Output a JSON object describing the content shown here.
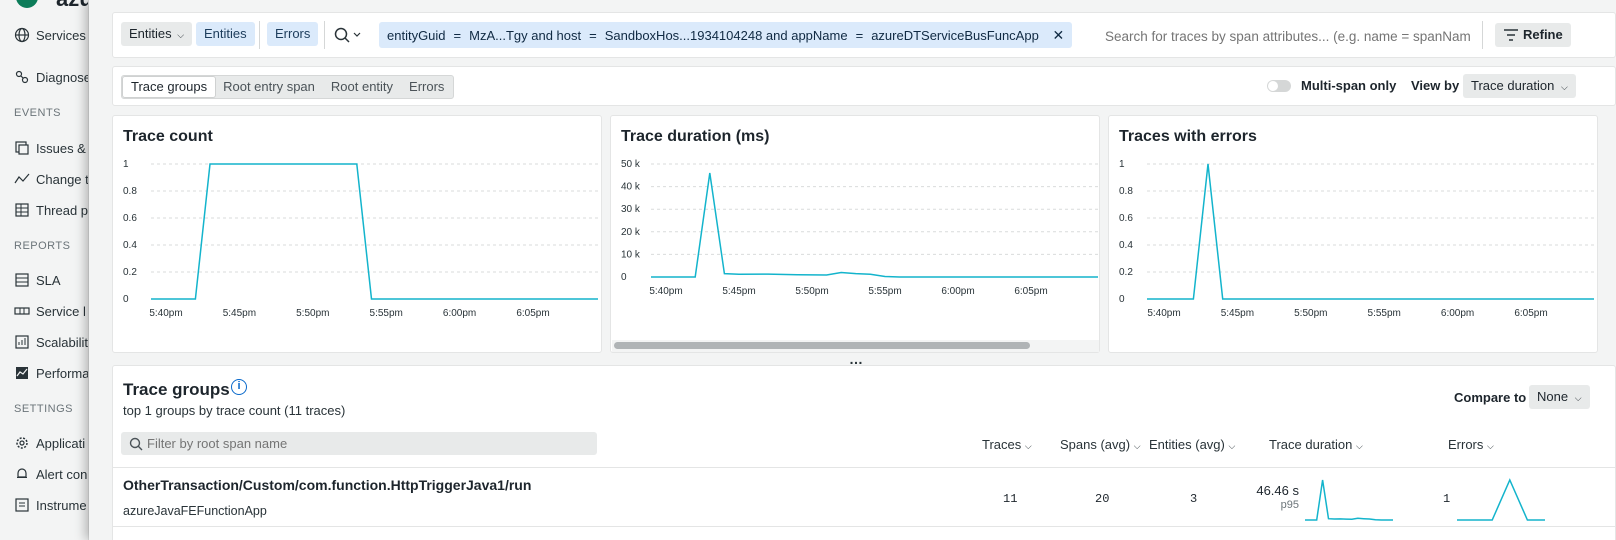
{
  "sidebar": {
    "app_name": "azu",
    "services_label": "Services",
    "items_top": [
      {
        "label": "Diagnose",
        "icon": "diagnose-icon"
      }
    ],
    "sections": [
      {
        "title": "EVENTS",
        "items": [
          {
            "label": "Issues &",
            "icon": "issues-icon"
          },
          {
            "label": "Change t",
            "icon": "change-tracking-icon"
          },
          {
            "label": "Thread p",
            "icon": "thread-profiler-icon"
          }
        ]
      },
      {
        "title": "REPORTS",
        "items": [
          {
            "label": "SLA",
            "icon": "sla-icon"
          },
          {
            "label": "Service l",
            "icon": "service-levels-icon"
          },
          {
            "label": "Scalabilit",
            "icon": "scalability-icon"
          },
          {
            "label": "Performa",
            "icon": "performance-icon"
          }
        ]
      },
      {
        "title": "SETTINGS",
        "items": [
          {
            "label": "Applicati",
            "icon": "application-icon"
          },
          {
            "label": "Alert con",
            "icon": "alert-icon"
          },
          {
            "label": "Instrume",
            "icon": "instrumentation-icon"
          }
        ]
      }
    ]
  },
  "filterbar": {
    "entities_dropdown": "Entities",
    "entities_chip": "Entities",
    "errors_chip": "Errors",
    "query": {
      "entityGuid_key": "entityGuid",
      "entityGuid_value": "MzA...Tgy and host",
      "host_value": "SandboxHos...1934104248 and appName",
      "appName_value": "azureDTServiceBusFuncApp",
      "op": "="
    },
    "search_placeholder": "Search for traces by span attributes... (e.g. name = spanNam",
    "refine_label": "Refine"
  },
  "tabs": [
    "Trace groups",
    "Root entry span",
    "Root entity",
    "Errors"
  ],
  "active_tab": "Trace groups",
  "multispan_label": "Multi-span only",
  "viewby_label": "View by",
  "viewby_value": "Trace duration",
  "colors": {
    "line": "#13b4cc",
    "accent": "#0b6acb"
  },
  "chart_data": [
    {
      "type": "line",
      "title": "Trace count",
      "x_ticks": [
        "5:40pm",
        "5:45pm",
        "5:50pm",
        "5:55pm",
        "6:00pm",
        "6:05pm"
      ],
      "y_ticks": [
        "0",
        "0.2",
        "0.4",
        "0.6",
        "0.8",
        "1"
      ],
      "ylim": [
        0,
        1
      ],
      "series": [
        {
          "x_minutes": [
            -3,
            0,
            2,
            3,
            13,
            14,
            15,
            32
          ],
          "values": [
            0,
            0,
            0,
            1,
            1,
            0,
            0,
            0
          ]
        }
      ]
    },
    {
      "type": "line",
      "title": "Trace duration (ms)",
      "x_ticks": [
        "5:40pm",
        "5:45pm",
        "5:50pm",
        "5:55pm",
        "6:00pm",
        "6:05pm"
      ],
      "y_ticks": [
        "0",
        "10 k",
        "20 k",
        "30 k",
        "40 k",
        "50 k"
      ],
      "ylim": [
        0,
        50000
      ],
      "series": [
        {
          "x_minutes": [
            -3,
            0,
            2,
            3,
            4,
            5,
            7,
            9,
            11,
            12,
            13,
            14,
            15,
            16,
            18,
            32
          ],
          "values": [
            0,
            0,
            0,
            46000,
            1500,
            1200,
            1300,
            1000,
            900,
            2000,
            1500,
            1200,
            200,
            0,
            0,
            0
          ]
        }
      ]
    },
    {
      "type": "line",
      "title": "Traces with errors",
      "x_ticks": [
        "5:40pm",
        "5:45pm",
        "5:50pm",
        "5:55pm",
        "6:00pm",
        "6:05pm"
      ],
      "y_ticks": [
        "0",
        "0.2",
        "0.4",
        "0.6",
        "0.8",
        "1"
      ],
      "ylim": [
        0,
        1
      ],
      "series": [
        {
          "x_minutes": [
            -3,
            0,
            2,
            3,
            4,
            32
          ],
          "values": [
            0,
            0,
            0,
            1,
            0,
            0
          ]
        }
      ]
    }
  ],
  "trace_groups": {
    "title": "Trace groups",
    "subtitle": "top 1 groups by trace count (11 traces)",
    "compare_label": "Compare to",
    "compare_value": "None",
    "filter_placeholder": "Filter by root span name",
    "columns": [
      "Traces",
      "Spans (avg)",
      "Entities (avg)",
      "Trace duration",
      "Errors"
    ],
    "rows": [
      {
        "name": "OtherTransaction/Custom/com.function.HttpTriggerJava1/run",
        "entity": "azureJavaFEFunctionApp",
        "traces": "11",
        "spans": "20",
        "entities": "3",
        "duration": "46.46 s",
        "duration_stat": "p95",
        "errors": "1"
      }
    ]
  }
}
